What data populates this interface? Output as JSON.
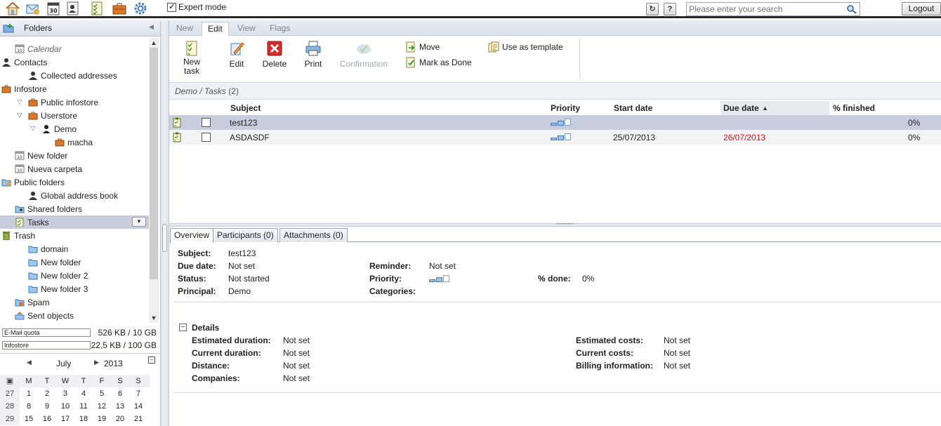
{
  "topbar": {
    "icons": [
      "home-icon",
      "mail-icon",
      "calendar-icon",
      "contacts-icon",
      "tasks-icon",
      "infostore-icon",
      "settings-icon"
    ],
    "expert_mode_label": "Expert mode",
    "expert_mode_checked": true,
    "search_placeholder": "Please enter your search",
    "logout_label": "Logout"
  },
  "sidebar": {
    "header": "Folders",
    "tree": [
      {
        "label": "Calendar",
        "icon": "calendar-icon",
        "indent": 1,
        "italic": true
      },
      {
        "label": "Contacts",
        "icon": "contacts-icon",
        "indent": 0,
        "expand": true
      },
      {
        "label": "Collected addresses",
        "icon": "contacts-icon",
        "indent": 2
      },
      {
        "label": "Infostore",
        "icon": "infostore-icon",
        "indent": 0,
        "expand": true
      },
      {
        "label": "Public infostore",
        "icon": "infostore-icon",
        "indent": 2,
        "expand": true
      },
      {
        "label": "Userstore",
        "icon": "infostore-icon",
        "indent": 2,
        "expand": true
      },
      {
        "label": "Demo",
        "icon": "user-icon",
        "indent": 3,
        "expand": true
      },
      {
        "label": "macha",
        "icon": "infostore-icon",
        "indent": 4
      },
      {
        "label": "New folder",
        "icon": "calendar-icon",
        "indent": 1
      },
      {
        "label": "Nueva carpeta",
        "icon": "calendar-icon",
        "indent": 1
      },
      {
        "label": "Public folders",
        "icon": "public-folder-icon",
        "indent": 0,
        "expand": true
      },
      {
        "label": "Global address book",
        "icon": "contacts-icon",
        "indent": 2
      },
      {
        "label": "Shared folders",
        "icon": "shared-folder-icon",
        "indent": 1
      },
      {
        "label": "Tasks",
        "icon": "tasks-icon",
        "indent": 1,
        "selected": true
      },
      {
        "label": "Trash",
        "icon": "trash-icon",
        "indent": 0,
        "expand": true
      },
      {
        "label": "domain",
        "icon": "folder-icon",
        "indent": 2
      },
      {
        "label": "New folder",
        "icon": "folder-icon",
        "indent": 2
      },
      {
        "label": "New folder 2",
        "icon": "folder-icon",
        "indent": 2
      },
      {
        "label": "New folder 3",
        "icon": "folder-icon",
        "indent": 2
      },
      {
        "label": "Spam",
        "icon": "spam-icon",
        "indent": 1
      },
      {
        "label": "Sent objects",
        "icon": "sent-icon",
        "indent": 1
      }
    ],
    "quota": [
      {
        "label": "E-Mail quota",
        "value": "526 KB / 10 GB"
      },
      {
        "label": "Infostore",
        "value": "22,5 KB / 100 GB"
      }
    ]
  },
  "minical": {
    "month": "July",
    "year": "2013",
    "weekdays": [
      "M",
      "T",
      "W",
      "T",
      "F",
      "S",
      "S"
    ],
    "weeks": [
      {
        "wk": "27",
        "days": [
          "1",
          "2",
          "3",
          "4",
          "5",
          "6",
          "7"
        ]
      },
      {
        "wk": "28",
        "days": [
          "8",
          "9",
          "10",
          "11",
          "12",
          "13",
          "14"
        ]
      },
      {
        "wk": "29",
        "days": [
          "15",
          "16",
          "17",
          "18",
          "19",
          "20",
          "21"
        ]
      }
    ]
  },
  "tabs": [
    {
      "label": "New",
      "active": false
    },
    {
      "label": "Edit",
      "active": true
    },
    {
      "label": "View",
      "active": false
    },
    {
      "label": "Flags",
      "active": false
    }
  ],
  "toolbar": {
    "new_task_line1": "New",
    "new_task_line2": "task",
    "edit": "Edit",
    "delete": "Delete",
    "print": "Print",
    "confirmation": "Confirmation",
    "move": "Move",
    "mark_done": "Mark as Done",
    "use_template": "Use as template"
  },
  "path": "Demo / Tasks",
  "path_count": "(2)",
  "grid": {
    "headers": {
      "subject": "Subject",
      "priority": "Priority",
      "start": "Start date",
      "due": "Due date",
      "finished": "% finished"
    },
    "sort_arrow": "▲",
    "rows": [
      {
        "subject": "test123",
        "priority": 2,
        "start": "",
        "due": "",
        "finished": "0%",
        "selected": true,
        "overdue": false
      },
      {
        "subject": "ASDASDF",
        "priority": 2,
        "start": "25/07/2013",
        "due": "26/07/2013",
        "finished": "0%",
        "selected": false,
        "overdue": true
      }
    ]
  },
  "detail_tabs": [
    "Overview",
    "Participants (0)",
    "Attachments (0)"
  ],
  "overview": {
    "subject_label": "Subject:",
    "subject": "test123",
    "due_label": "Due date:",
    "due": "Not set",
    "status_label": "Status:",
    "status": "Not started",
    "principal_label": "Principal:",
    "principal": "Demo",
    "reminder_label": "Reminder:",
    "reminder": "Not set",
    "priority_label": "Priority:",
    "priority": 2,
    "categories_label": "Categories:",
    "done_label": "% done:",
    "done": "0%"
  },
  "details": {
    "title": "Details",
    "est_duration_label": "Estimated duration:",
    "est_duration": "Not set",
    "cur_duration_label": "Current duration:",
    "cur_duration": "Not set",
    "distance_label": "Distance:",
    "distance": "Not set",
    "companies_label": "Companies:",
    "companies": "Not set",
    "est_costs_label": "Estimated costs:",
    "est_costs": "Not set",
    "cur_costs_label": "Current costs:",
    "cur_costs": "Not set",
    "billing_label": "Billing information:",
    "billing": "Not set"
  }
}
